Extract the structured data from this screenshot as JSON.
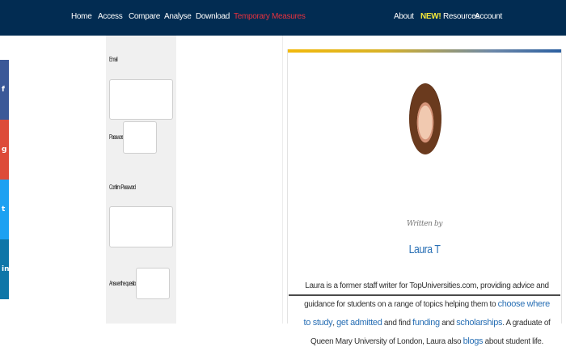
{
  "nav": {
    "home": "Home",
    "access": "Access",
    "compare": "Compare",
    "analyse": "Analyse",
    "download": "Download",
    "temporary_measures": "Temporary Measures",
    "about": "About",
    "new_badge": "NEW!",
    "resources": "Resources",
    "account": "Account"
  },
  "social": [
    {
      "icon": "facebook-icon",
      "glyph": "f",
      "color": "#3b5998"
    },
    {
      "icon": "google-plus-icon",
      "glyph": "g",
      "color": "#dd4b39"
    },
    {
      "icon": "twitter-icon",
      "glyph": "t",
      "color": "#1da1f2"
    },
    {
      "icon": "linkedin-icon",
      "glyph": "in",
      "color": "#0e76a8"
    }
  ],
  "form": {
    "email_label": "Email",
    "password_label": "Password",
    "confirm_label": "Confirm Password",
    "answer_label": "Answer the question"
  },
  "author_card": {
    "written_by": "Written by",
    "name": "Laura T",
    "bio_part1": "Laura is a former staff writer for TopUniversities.com, providing advice and guidance for students on a range of topics helping them to ",
    "link_study": "choose where to study",
    "sep1": ", ",
    "link_admitted": "get admitted",
    "bio_part2": " and find ",
    "link_funding": "funding",
    "bio_part3": " and ",
    "link_scholarships": "scholarships",
    "bio_part4": ". A graduate of Queen Mary University of London, Laura also ",
    "link_blogs": "blogs",
    "bio_part5": " about student life."
  },
  "colors": {
    "nav_bg": "#022c52",
    "accent_red": "#e8313e",
    "new_yellow": "#f5e83a",
    "link_blue": "#2a70b5"
  }
}
